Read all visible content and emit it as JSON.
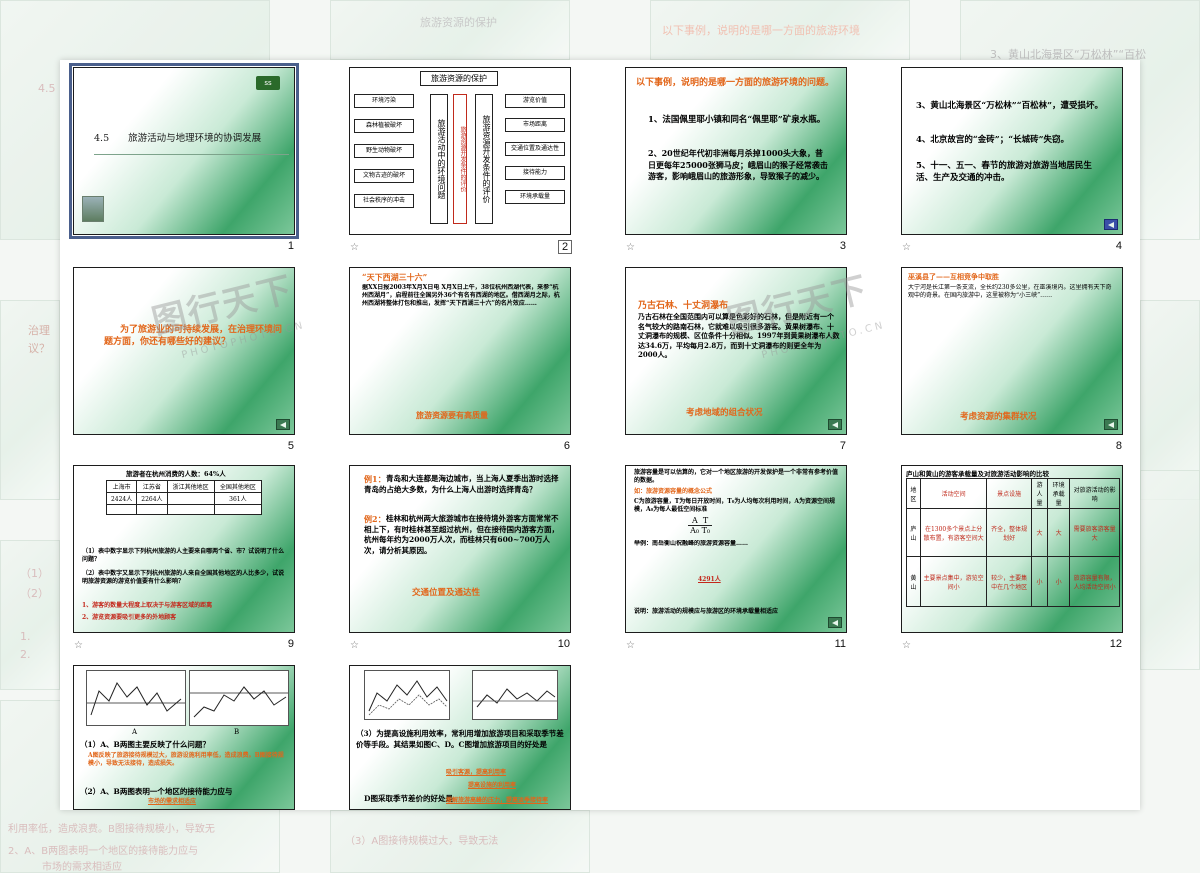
{
  "background": {
    "ghost_texts": [
      "4.5",
      "旅游资源的保护",
      "以下事例，说明的是哪一方面的旅游环境",
      "3、黄山北海景区“万松林”“百松",
      "治理",
      "议？",
      "（1）",
      "（2）",
      "1.",
      "2.",
      "利用率低，造成浪费。B图接待规模小，导致无",
      "2、A、B两图表明一个地区的接待能力应与",
      "市场的需求相适应",
      "（3）A图接待规模过大，导致无法"
    ]
  },
  "watermark": {
    "text": "图行天下",
    "sub": "PHOTOPHOTO.CN"
  },
  "slides": [
    {
      "num": "1",
      "title": "4.5　　旅游活动与地理环境的协调发展",
      "logo": "ss"
    },
    {
      "num": "2",
      "title": "旅游资源的保护",
      "left_items": [
        "环境污染",
        "森林植被破坏",
        "野生动物破坏",
        "文物古迹的破坏",
        "社会秩序的冲击"
      ],
      "center_a": "旅游活动中的环境问题",
      "center_b": "旅游资源开发条件的评价",
      "center_c": "旅游资源开发条件的评价",
      "right_items": [
        "游览价值",
        "市场距离",
        "交通位置及通达性",
        "接待能力",
        "环境承载量"
      ]
    },
    {
      "num": "3",
      "heading": "以下事例，说明的是哪一方面的旅游环境的问题。",
      "items": [
        "1、法国佩里耶小镇和同名“佩里耶”矿泉水瓶。",
        "2、20世纪年代初非洲每月杀掉1000头大象，昔日更每年25000张狮马皮；峨眉山的猴子经常袭击游客，影响峨眉山的旅游形象，导致猴子的减少。"
      ]
    },
    {
      "num": "4",
      "items": [
        "3、黄山北海景区“万松林”“百松林”，遭受损坏。",
        "4、北京故宫的“金砖”；“长城砖”失窃。",
        "5、十一、五一、春节的旅游对旅游当地居民生活、生产及交通的冲击。"
      ]
    },
    {
      "num": "5",
      "text": "为了旅游业的可持续发展，在治理环境问题方面，你还有哪些好的建议？"
    },
    {
      "num": "6",
      "heading": "“天下西湖三十六”",
      "body": "据XX日报2003年X月X日电 X月X日上午，38位杭州西湖代表，来参“杭州西湖月”，启程前往全国另外36个有名有西湖的地区。借西湖月之际，杭州西湖将整体打包和推出，发挥“天下西湖三十六”的名片效应……",
      "caption": "旅游资源要有高质量"
    },
    {
      "num": "7",
      "heading": "乃古石林、十丈洞瀑布",
      "body": "乃古石林在全国范围内可以算是色彩好的石林，但是附近有一个名气较大的路南石林，它就难以吸引很多游客。黄果树瀑布、十丈洞瀑布的规模、区位条件十分相似。1997年到黄果树瀑布人数达34.6万，平均每月2.8万，而到十丈洞瀑布的则更全年为2000人。",
      "caption": "考虑地域的组合状况"
    },
    {
      "num": "8",
      "heading": "巫溪县了——互相竞争中取胜",
      "body": "大宁河是长江第一条支流，全长约230多公里，在巫溪境内。这里拥有天下奇观中的奇景。在国内旅游中，这里被称为“小三峡”……",
      "caption": "考虑资源的集群状况"
    },
    {
      "num": "9",
      "heading": "旅游者在杭州消费的人数：64%人",
      "table_head": [
        "上海市",
        "江苏省",
        "浙江其他地区",
        "全国其他地区"
      ],
      "table_row1": [
        "2424人",
        "2264人",
        "",
        "361人"
      ],
      "q1": "（1）表中数字显示下列杭州旅游的人主要来自哪两个省、市？试说明了什么问题？",
      "q2": "（2）表中数字又显示下列杭州旅游的人来自全国其他地区的人比多少，试说明旅游资源的游览价值要有什么影响？",
      "a1": "1、游客的数量大程度上取决于与游客区域的距离",
      "a2": "2、游览资源要吸引更多的外地顾客"
    },
    {
      "num": "10",
      "heading": "例1：",
      "body": "青岛和大连都是海边城市，当上海人夏季出游时选择青岛的占绝大多数，为什么上海人出游时选择青岛？",
      "heading2": "例2：",
      "body2": "桂林和杭州两大旅游城市在接待境外游客方面常常不相上下，有时桂林甚至超过杭州，但在接待国内游客方面，杭州每年约为2000万人次，而桂林只有600~700万人次，请分析其原因。",
      "caption": "交通位置及通达性"
    },
    {
      "num": "11",
      "body": "旅游容量是可以估算的，它对一个地区旅游的开发保护是一个非常有参考价值的数据。",
      "formula_title": "如：旅游资源容量的概念公式",
      "formula_text": "C为旅游容量，T为每日开放时间，T₀为人均每次利用时间，A为资源空间规模，A₀为每人最低空间标准",
      "example": "举例：南岳衡山祝融峰的旅游资源容量……",
      "answer": "4291人",
      "conclusion": "说明：旅游活动的规模应与旅游区的环境承载量相适应"
    },
    {
      "num": "12",
      "heading": "庐山和黄山的游客承载量及对旅游活动影响的比较",
      "table_head": [
        "地区",
        "活动空间",
        "景点设施",
        "游人量",
        "环境承载量",
        "对旅游活动的影响"
      ],
      "row1": [
        "庐山",
        "在1300多个景点上分散布置，有游客空间大",
        "齐全，整体规划好",
        "大",
        "大",
        "需要旅客游客量大"
      ],
      "row2": [
        "黄山",
        "主要景点集中，游览空间小",
        "较少，主要集中在几个地区",
        "小",
        "小",
        "旅游容量有限，人均活动空间小"
      ]
    },
    {
      "num": "",
      "chart_label_a": "A",
      "chart_label_b": "B",
      "q1": "（1）A、B两图主要反映了什么问题？",
      "a1": "A图反映了旅游接待规模过大，旅游设施利用率低，造成浪费。B图接待规模小，导致无法接待，造成损失。",
      "q2": "（2）A、B两图表明一个地区的接待能力应与",
      "a2": "市场的需求相适应"
    },
    {
      "num": "",
      "q3": "（3）为提高设施利用效率，常利用增加旅游项目和采取季节差价等手段。其结果如图C、D。C图增加旅游项目的好处是",
      "a3a": "吸引客源，提高利用率",
      "a3b": "提高设施的利用率",
      "q4": "D图采取季节差价的好处是",
      "a4": "缓解旅游高峰的压力，提高淡季接待率"
    }
  ]
}
